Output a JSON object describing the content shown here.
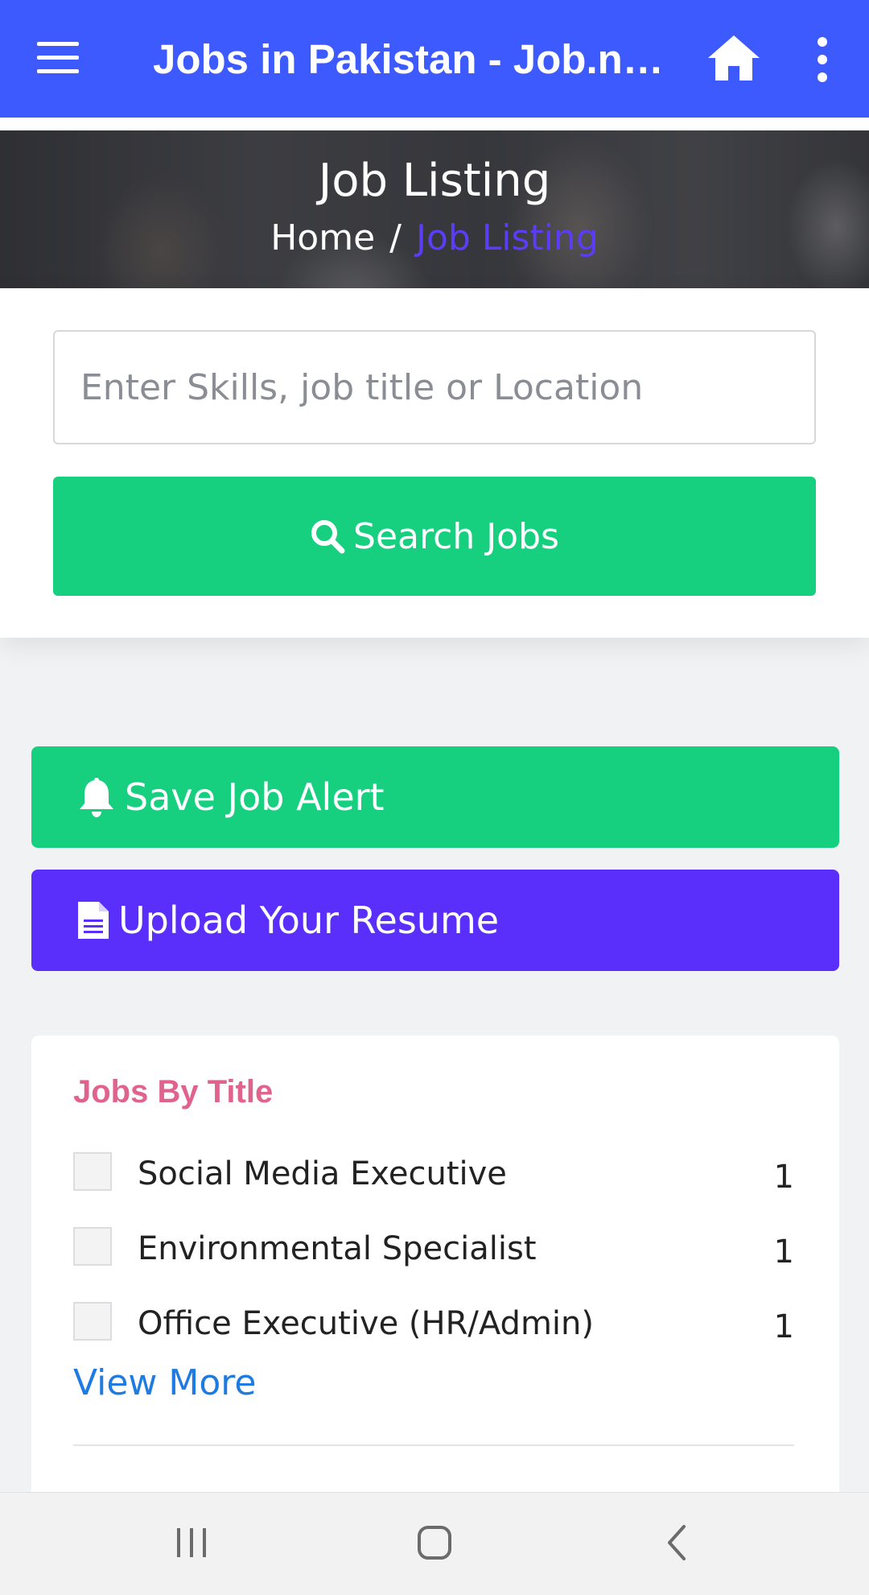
{
  "appbar": {
    "title": "Jobs in Pakistan - Job.net.pk"
  },
  "hero": {
    "title": "Job Listing",
    "breadcrumb": {
      "home": "Home",
      "separator": "/",
      "current": "Job Listing"
    }
  },
  "search": {
    "placeholder": "Enter Skills, job title or Location",
    "button_label": "Search Jobs"
  },
  "actions": {
    "save_alert_label": "Save Job Alert",
    "upload_resume_label": "Upload Your Resume"
  },
  "filters": {
    "heading": "Jobs By Title",
    "items": [
      {
        "label": "Social Media Executive",
        "count": "1"
      },
      {
        "label": "Environmental Specialist",
        "count": "1"
      },
      {
        "label": "Office Executive (HR/Admin)",
        "count": "1"
      }
    ],
    "view_more": "View More"
  },
  "colors": {
    "appbar": "#3d5afe",
    "green": "#17d07f",
    "purple": "#5b2ffb",
    "heading_pink": "#e0638e",
    "link_blue": "#1e7be2"
  },
  "icons": [
    "menu-icon",
    "home-icon",
    "more-vert-icon",
    "search-icon",
    "bell-icon",
    "document-icon",
    "recents-icon",
    "home-nav-icon",
    "back-icon"
  ]
}
